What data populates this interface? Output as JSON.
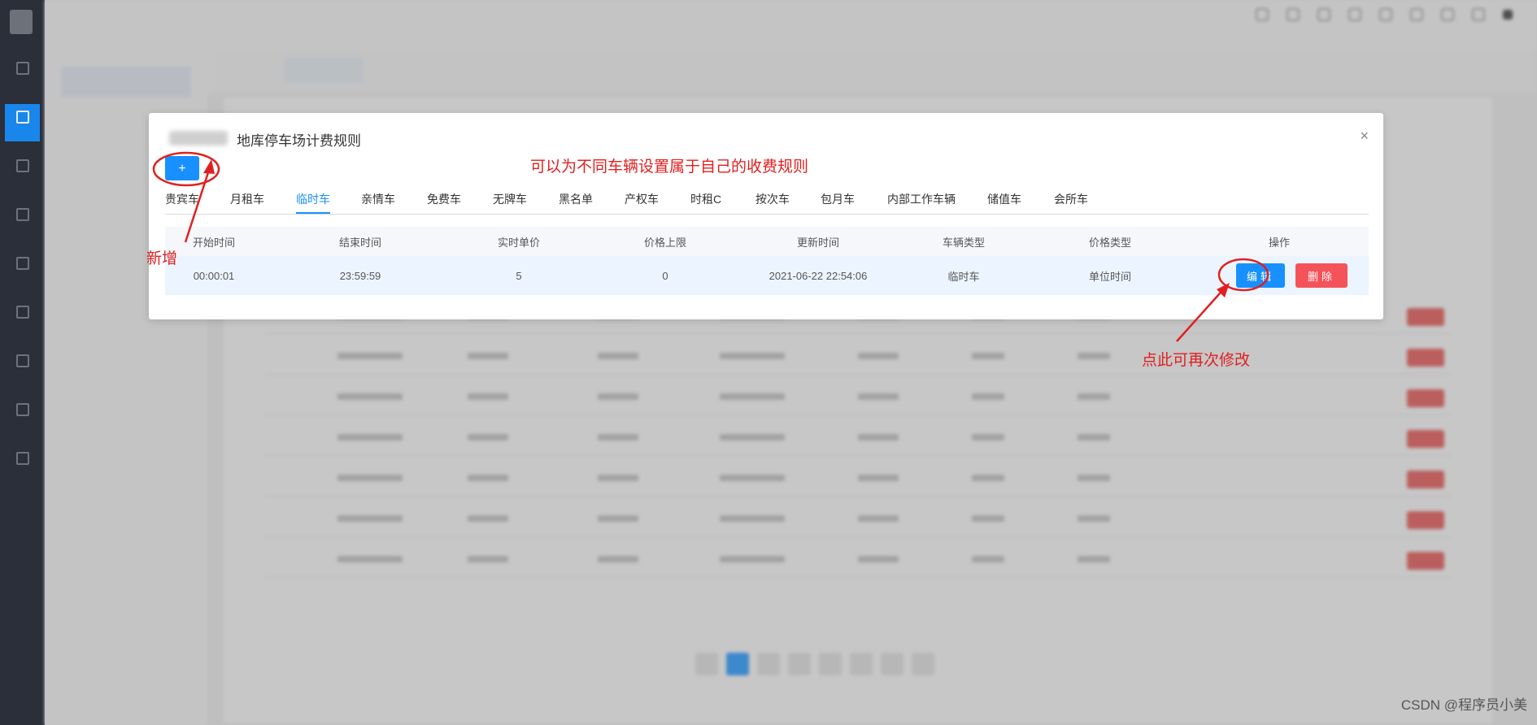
{
  "dialog": {
    "title": "地库停车场计费规则",
    "close_label": "×",
    "add_label": "+",
    "tabs": [
      "贵宾车",
      "月租车",
      "临时车",
      "亲情车",
      "免费车",
      "无牌车",
      "黑名单",
      "产权车",
      "时租C",
      "按次车",
      "包月车",
      "内部工作车辆",
      "储值车",
      "会所车"
    ],
    "active_tab": "临时车",
    "columns": [
      "开始时间",
      "结束时间",
      "实时单价",
      "价格上限",
      "更新时间",
      "车辆类型",
      "价格类型",
      "操作"
    ],
    "rows": [
      {
        "start": "00:00:01",
        "end": "23:59:59",
        "unit_price": "5",
        "price_cap": "0",
        "updated": "2021-06-22 22:54:06",
        "vehicle_type": "临时车",
        "price_type": "单位时间",
        "edit_label": "编辑",
        "delete_label": "删除"
      }
    ]
  },
  "annotations": {
    "main": "可以为不同车辆设置属于自己的收费规则",
    "add": "新增",
    "edit": "点此可再次修改"
  },
  "watermark": "CSDN @程序员小美",
  "colors": {
    "primary": "#1890ff",
    "danger": "#f5535a",
    "annotation": "#e02020",
    "nav": "#2b2f3a"
  },
  "icons": [
    "logo-icon",
    "close-icon",
    "plus-icon",
    "arrow-icon"
  ]
}
